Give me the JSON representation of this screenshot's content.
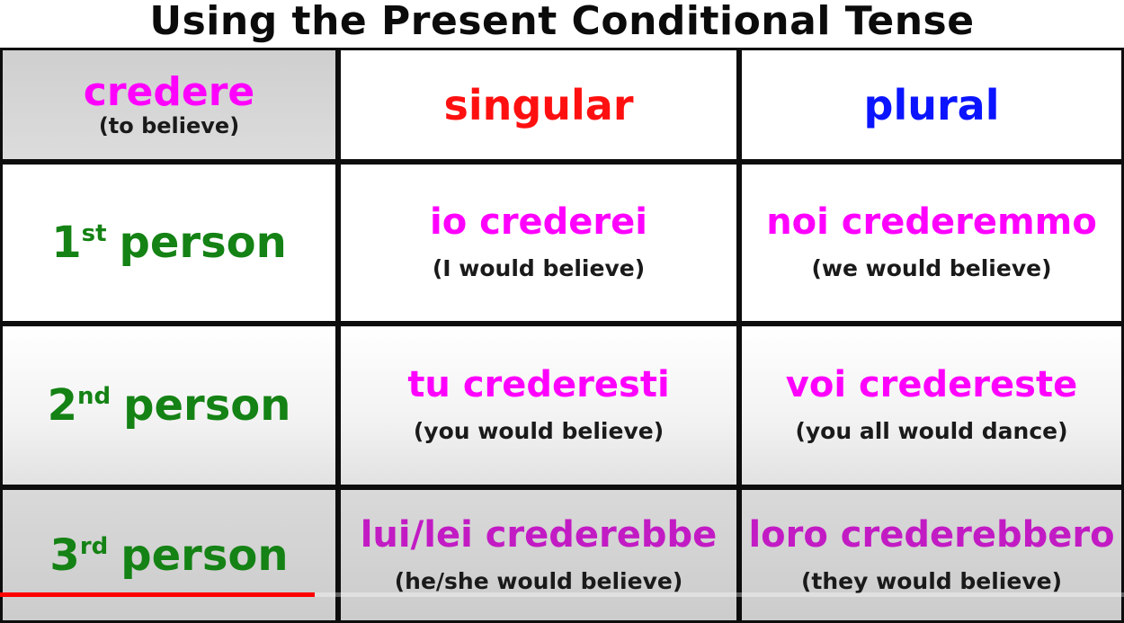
{
  "title": "Using the Present Conditional Tense",
  "corner": {
    "verb": "credere",
    "gloss": "(to believe)"
  },
  "columns": {
    "singular": "singular",
    "plural": "plural"
  },
  "rows": [
    {
      "num": "1",
      "suffix": "st",
      "label": "person",
      "singular": {
        "form": "io crederei",
        "gloss": "(I would believe)"
      },
      "plural": {
        "form": "noi crederemmo",
        "gloss": "(we would believe)"
      }
    },
    {
      "num": "2",
      "suffix": "nd",
      "label": "person",
      "singular": {
        "form": "tu crederesti",
        "gloss": "(you would believe)"
      },
      "plural": {
        "form": "voi credereste",
        "gloss": "(you all would dance)"
      }
    },
    {
      "num": "3",
      "suffix": "rd",
      "label": "person",
      "singular": {
        "form": "lui/lei crederebbe",
        "gloss": "(he/she would believe)"
      },
      "plural": {
        "form": "loro crederebbero",
        "gloss": "(they would believe)"
      }
    }
  ],
  "colors": {
    "verb": "#ff00ff",
    "singular": "#ff1010",
    "plural": "#0a14ff",
    "person": "#148214",
    "progress": "#ff0000"
  },
  "video_progress": 0.28
}
